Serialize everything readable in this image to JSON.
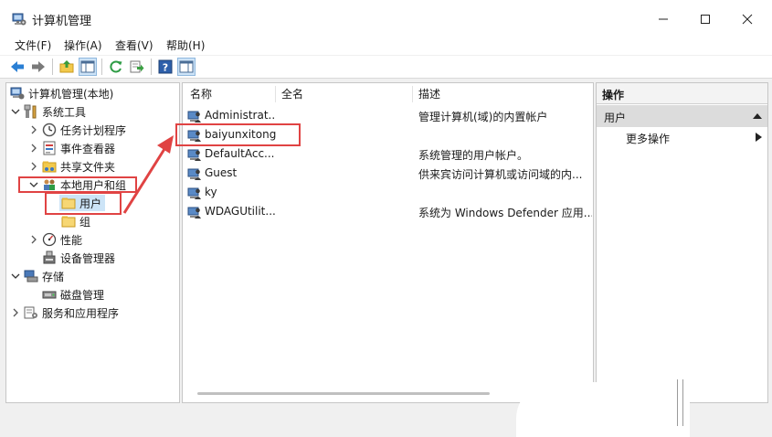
{
  "window": {
    "title": "计算机管理"
  },
  "menu": [
    "文件(F)",
    "操作(A)",
    "查看(V)",
    "帮助(H)"
  ],
  "tree": {
    "root": "计算机管理(本地)",
    "system_tools": "系统工具",
    "task_scheduler": "任务计划程序",
    "event_viewer": "事件查看器",
    "shared_folders": "共享文件夹",
    "local_users_groups": "本地用户和组",
    "users": "用户",
    "groups": "组",
    "performance": "性能",
    "device_manager": "设备管理器",
    "storage": "存储",
    "disk_management": "磁盘管理",
    "services_apps": "服务和应用程序"
  },
  "list": {
    "columns": [
      "名称",
      "全名",
      "描述"
    ],
    "rows": [
      {
        "name": "Administrat...",
        "full_name": "",
        "description": "管理计算机(域)的内置帐户"
      },
      {
        "name": "baiyunxitong",
        "full_name": "",
        "description": ""
      },
      {
        "name": "DefaultAcc...",
        "full_name": "",
        "description": "系统管理的用户帐户。"
      },
      {
        "name": "Guest",
        "full_name": "",
        "description": "供来宾访问计算机或访问域的内..."
      },
      {
        "name": "ky",
        "full_name": "",
        "description": ""
      },
      {
        "name": "WDAGUtilit...",
        "full_name": "",
        "description": "系统为 Windows Defender 应用..."
      }
    ]
  },
  "actions": {
    "title": "操作",
    "section": "用户",
    "more": "更多操作"
  },
  "colors": {
    "annotation": "#e04343",
    "selection": "#cce4f7",
    "accent": "#1f6fc5"
  }
}
